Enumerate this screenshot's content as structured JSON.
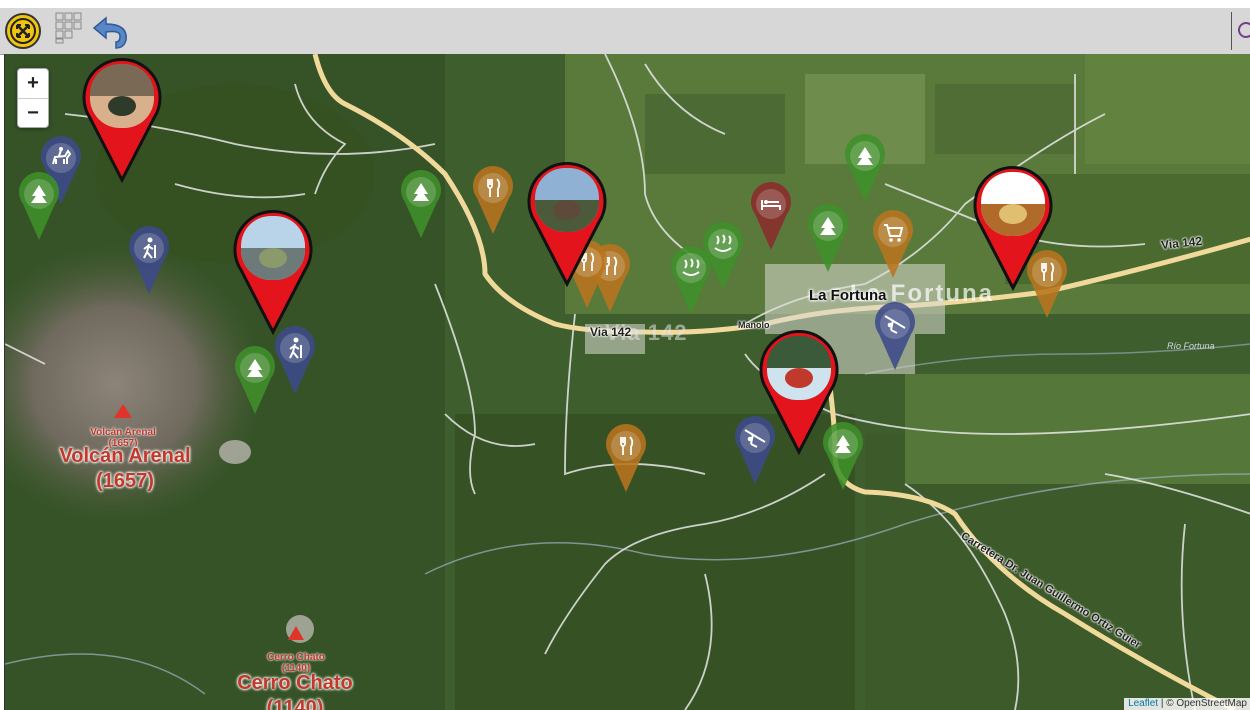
{
  "toolbar": {
    "logo_icon": "crossed-arrows-icon",
    "grid_icon": "grid-icon",
    "back_icon": "undo-arrow-icon"
  },
  "zoom": {
    "in_label": "+",
    "out_label": "−"
  },
  "map": {
    "town_label": "La Fortuna",
    "town_shadow": "La Fortuna",
    "small_place": "Manolo",
    "road_label_1": "Via 142",
    "road_label_2": "Via 142",
    "road_shadow": "Via 142",
    "road_label_3": "Carretera Dr. Juan Guillermo Ortiz Guier",
    "river_1": "Río Fortuna",
    "peaks": [
      {
        "small": "Volcán Arenal",
        "small_elev": "(1657)",
        "big": "Volcán Arenal",
        "big_elev": "(1657)"
      },
      {
        "small": "Cerro Chato",
        "small_elev": "(1140)",
        "big": "Cerro Chato",
        "big_elev": "(1140)"
      }
    ]
  },
  "markers": [
    {
      "type": "horse-riding",
      "color": "#3e4a8a"
    },
    {
      "type": "forest",
      "color": "#3f8f2a"
    },
    {
      "type": "hiking",
      "color": "#3e4a8a"
    },
    {
      "type": "forest",
      "color": "#3f8f2a"
    },
    {
      "type": "hiking",
      "color": "#3e4a8a"
    },
    {
      "type": "forest",
      "color": "#3f8f2a"
    },
    {
      "type": "restaurant",
      "color": "#b8741e"
    },
    {
      "type": "restaurant",
      "color": "#b8741e"
    },
    {
      "type": "restaurant",
      "color": "#b8741e"
    },
    {
      "type": "hot-springs",
      "color": "#3f8f2a"
    },
    {
      "type": "hot-springs",
      "color": "#3f8f2a"
    },
    {
      "type": "hotel",
      "color": "#8a2b2b"
    },
    {
      "type": "forest",
      "color": "#3f8f2a"
    },
    {
      "type": "forest",
      "color": "#3f8f2a"
    },
    {
      "type": "shopping",
      "color": "#b8741e"
    },
    {
      "type": "restaurant",
      "color": "#b8741e"
    },
    {
      "type": "zipline",
      "color": "#3e4a8a"
    },
    {
      "type": "zipline",
      "color": "#3e4a8a"
    },
    {
      "type": "forest",
      "color": "#3f8f2a"
    },
    {
      "type": "restaurant",
      "color": "#b8741e"
    }
  ],
  "photo_markers": [
    {
      "subject": "couple-selfie"
    },
    {
      "subject": "volcano-hikers"
    },
    {
      "subject": "viewpoint-group"
    },
    {
      "subject": "waterfall-rappel"
    },
    {
      "subject": "food-plate"
    }
  ],
  "attribution": {
    "leaflet": "Leaflet",
    "osm": "| © OpenStreetMap"
  }
}
